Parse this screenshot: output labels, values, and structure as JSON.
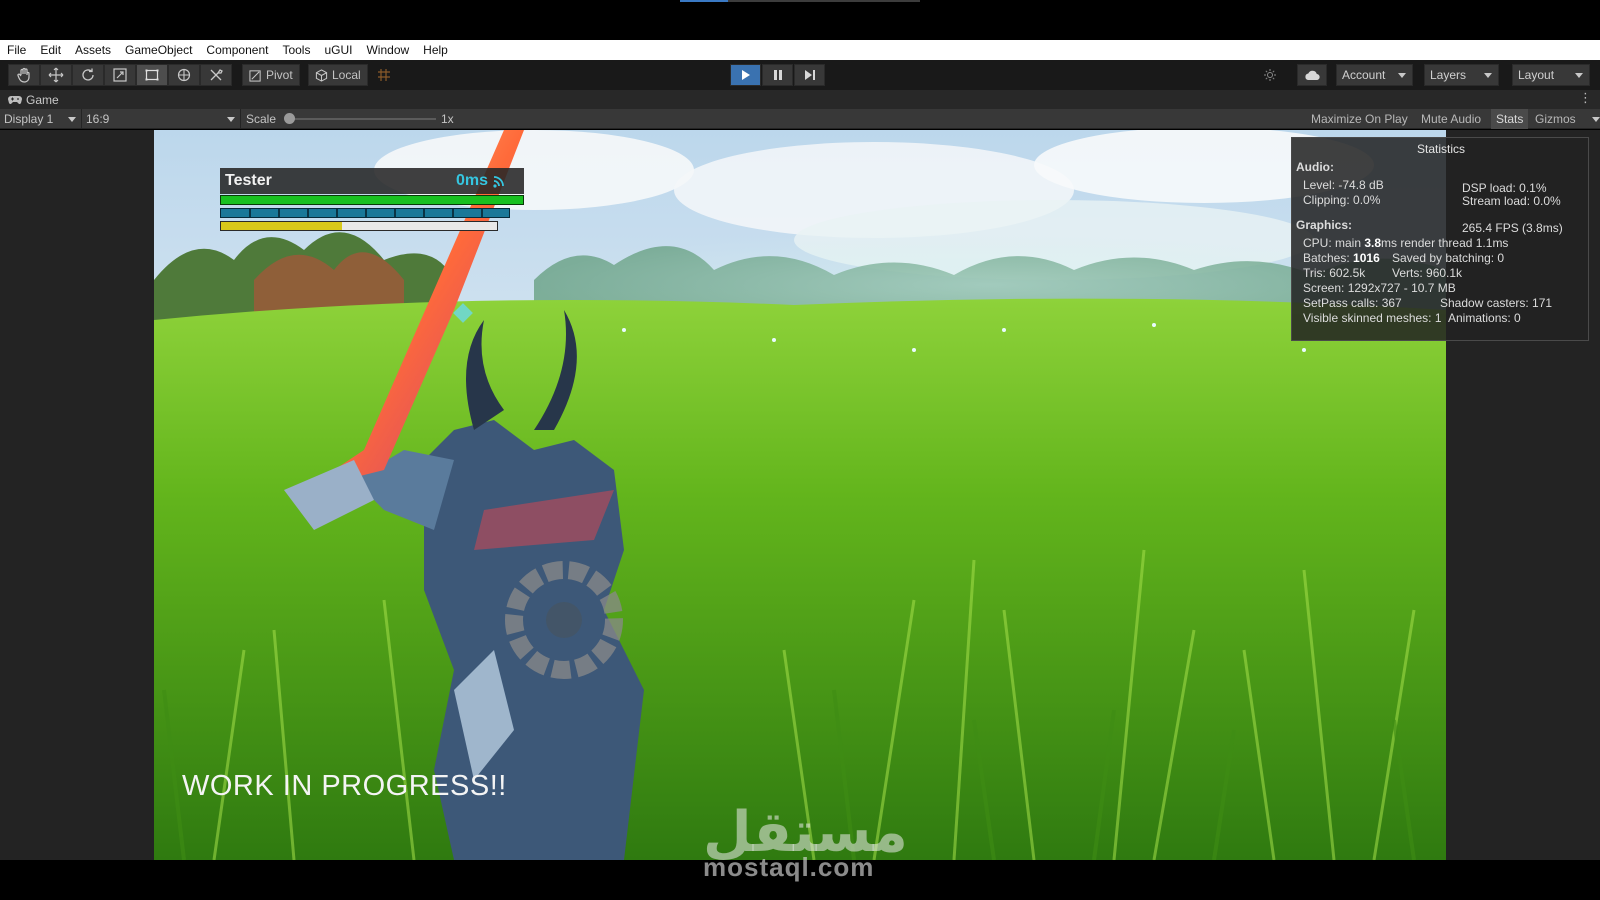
{
  "menubar": {
    "items": [
      "File",
      "Edit",
      "Assets",
      "GameObject",
      "Component",
      "Tools",
      "uGUI",
      "Window",
      "Help"
    ]
  },
  "toolbar": {
    "tools": [
      "hand-tool-icon",
      "move-tool-icon",
      "rotate-tool-icon",
      "scale-tool-icon",
      "rect-tool-icon",
      "transform-tool-icon",
      "custom-tool-icon"
    ],
    "pivot_label": "Pivot",
    "local_label": "Local",
    "account_label": "Account",
    "layers_label": "Layers",
    "layout_label": "Layout"
  },
  "tab": {
    "label": "Game"
  },
  "gamebar": {
    "display": "Display 1",
    "aspect": "16:9",
    "scale_label": "Scale",
    "scale_value": "1x",
    "maximize_label": "Maximize On Play",
    "mute_label": "Mute Audio",
    "stats_label": "Stats",
    "gizmos_label": "Gizmos"
  },
  "hud": {
    "player_name": "Tester",
    "ping": "0ms",
    "health_fraction": 1.0,
    "stamina_fraction": 0.44
  },
  "game": {
    "overlay_text": "WORK IN PROGRESS!!"
  },
  "stats": {
    "title": "Statistics",
    "audio_header": "Audio:",
    "level": "Level: -74.8 dB",
    "clipping": "Clipping: 0.0%",
    "dsp_load": "DSP load: 0.1%",
    "stream_load": "Stream load: 0.0%",
    "graphics_header": "Graphics:",
    "fps": "265.4 FPS (3.8ms)",
    "cpu_prefix": "CPU: main",
    "cpu_main": "3.8",
    "cpu_suffix": "ms  render thread 1.1ms",
    "batches_prefix": "Batches:",
    "batches_value": "1016",
    "saved_batching": "Saved by batching: 0",
    "tris": "Tris: 602.5k",
    "verts": "Verts: 960.1k",
    "screen": "Screen: 1292x727 - 10.7 MB",
    "setpass": "SetPass calls: 367",
    "shadow_casters": "Shadow casters: 171",
    "skinned_meshes": "Visible skinned meshes: 1",
    "animations": "Animations: 0"
  },
  "watermark": {
    "arabic": "مستقل",
    "text": "mostaql.com"
  },
  "colors": {
    "play_active": "#3a72b0",
    "health": "#18c020",
    "mana": "#1a7898",
    "stamina": "#d8c81a",
    "ping": "#35c6e0"
  }
}
